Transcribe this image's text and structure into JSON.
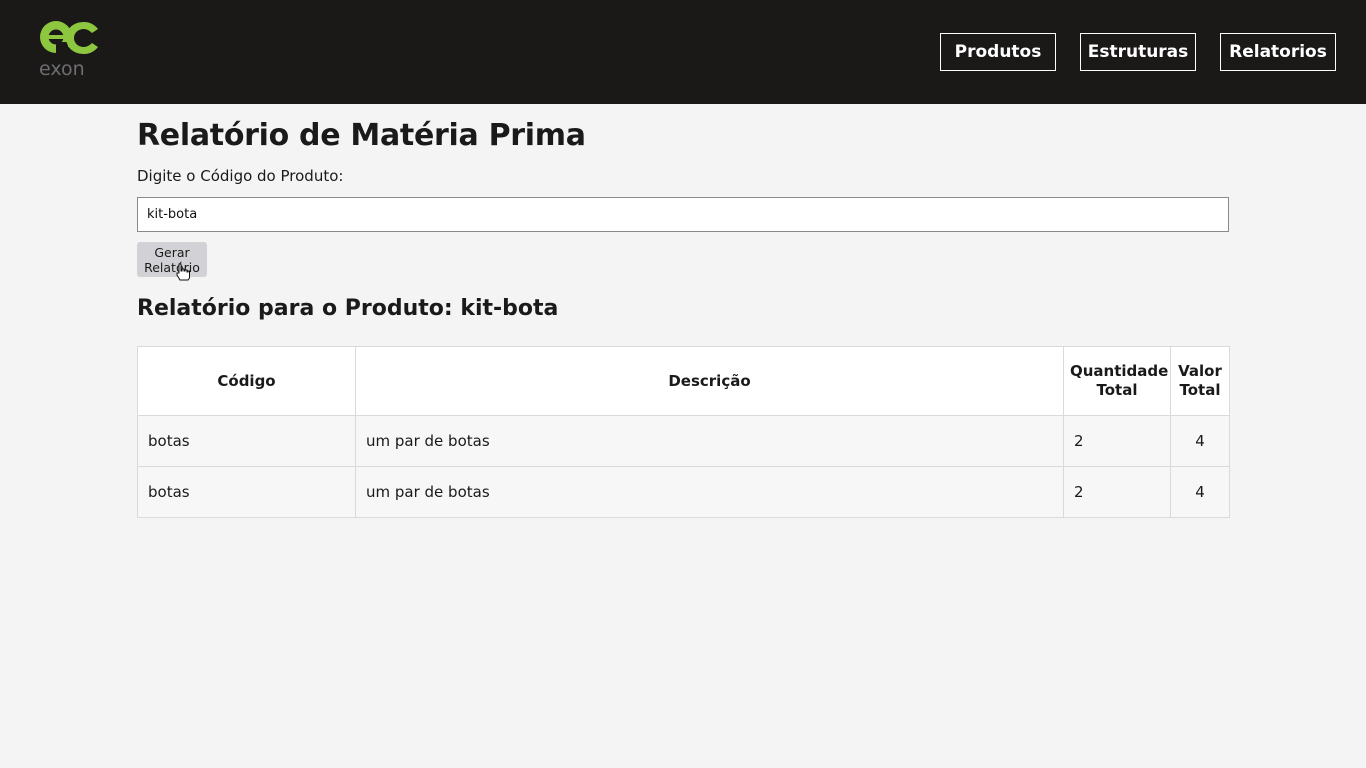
{
  "header": {
    "logo_text": "exon",
    "nav": [
      {
        "label": "Produtos"
      },
      {
        "label": "Estruturas"
      },
      {
        "label": "Relatorios"
      }
    ]
  },
  "page": {
    "title": "Relatório de Matéria Prima",
    "field_label": "Digite o Código do Produto:",
    "input_value": "kit-bota",
    "generate_button": "Gerar Relatório",
    "report_title": "Relatório para o Produto: kit-bota"
  },
  "table": {
    "headers": [
      "Código",
      "Descrição",
      "Quantidade Total",
      "Valor Total"
    ],
    "rows": [
      [
        "botas",
        "um par de botas",
        "2",
        "4"
      ],
      [
        "botas",
        "um par de botas",
        "2",
        "4"
      ]
    ]
  },
  "colors": {
    "header_bg": "#1b1818",
    "logo_green": "#8dc63f",
    "logo_gray": "#6d6e70",
    "page_bg": "#f4f4f4"
  }
}
